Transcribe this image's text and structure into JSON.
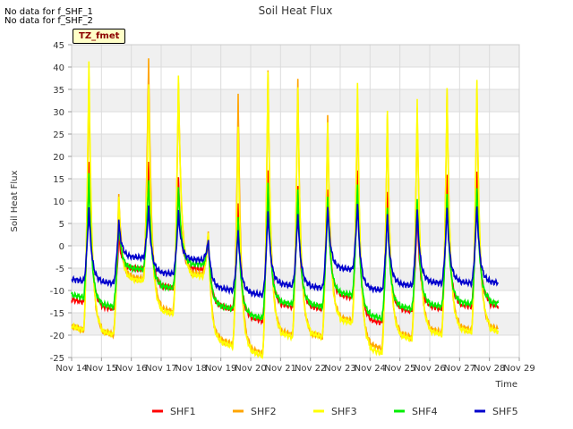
{
  "notes": [
    "No data for f_SHF_1",
    "No data for f_SHF_2"
  ],
  "tag_label": "TZ_fmet",
  "chart_data": {
    "type": "line",
    "title": "Soil Heat Flux",
    "xlabel": "Time",
    "ylabel": "Soil Heat Flux",
    "ylim": [
      -25,
      45
    ],
    "yticks": [
      -25,
      -20,
      -15,
      -10,
      -5,
      0,
      5,
      10,
      15,
      20,
      25,
      30,
      35,
      40,
      45
    ],
    "xlim": [
      14,
      29
    ],
    "xticks": [
      14,
      15,
      16,
      17,
      18,
      19,
      20,
      21,
      22,
      23,
      24,
      25,
      26,
      27,
      28,
      29
    ],
    "xtick_labels": [
      "Nov 14",
      "Nov 15",
      "Nov 16",
      "Nov 17",
      "Nov 18",
      "Nov 19",
      "Nov 20",
      "Nov 21",
      "Nov 22",
      "Nov 23",
      "Nov 24",
      "Nov 25",
      "Nov 26",
      "Nov 27",
      "Nov 28",
      "Nov 29"
    ],
    "grid": true,
    "legend_position": "bottom",
    "day_start": 14.0,
    "day_end": 28.3,
    "series": [
      {
        "name": "SHF1",
        "color": "#ff0000",
        "peaks": [
          19,
          2,
          18.5,
          15,
          1,
          9.5,
          17,
          13.5,
          12.5,
          16.5,
          11.5,
          8.5,
          15.5,
          16.5
        ],
        "troughs": [
          -12,
          -13.5,
          -5,
          -9,
          -5,
          -13.5,
          -16,
          -13,
          -13.5,
          -11,
          -16.5,
          -14,
          -13.5,
          -13,
          -12.5
        ]
      },
      {
        "name": "SHF2",
        "color": "#ffa500",
        "peaks": [
          38,
          12,
          42.5,
          37,
          3.5,
          34,
          39,
          37,
          29,
          33,
          29.5,
          31,
          35,
          35
        ],
        "troughs": [
          -18,
          -19,
          -7,
          -14,
          -6,
          -21,
          -23,
          -19,
          -19.5,
          -16,
          -22,
          -19.5,
          -18.5,
          -18,
          -18
        ]
      },
      {
        "name": "SHF3",
        "color": "#ffff00",
        "peaks": [
          41.5,
          11,
          36,
          38,
          3,
          27,
          39.5,
          36,
          28,
          36.5,
          30,
          32.5,
          35,
          37
        ],
        "troughs": [
          -18,
          -19,
          -7.5,
          -14.5,
          -6.5,
          -21.5,
          -23.5,
          -19.5,
          -19.5,
          -16.5,
          -23,
          -20,
          -19,
          -18.5,
          -18
        ]
      },
      {
        "name": "SHF4",
        "color": "#00ee00",
        "peaks": [
          16,
          5,
          15,
          13.5,
          1,
          6.5,
          14,
          12.5,
          11,
          14,
          9,
          11,
          12,
          13
        ],
        "troughs": [
          -11,
          -13,
          -5,
          -9,
          -4,
          -13.5,
          -15.5,
          -12.5,
          -13,
          -10.5,
          -15.5,
          -13.5,
          -13,
          -12.5,
          -12
        ]
      },
      {
        "name": "SHF5",
        "color": "#0000cc",
        "peaks": [
          8.5,
          5.5,
          8.5,
          7.5,
          1,
          3.5,
          8,
          7.5,
          9,
          9.5,
          7,
          8,
          8.5,
          9
        ],
        "troughs": [
          -7.5,
          -8,
          -2.5,
          -6,
          -3,
          -9.5,
          -10.5,
          -8.5,
          -9,
          -5,
          -9.5,
          -8.5,
          -8,
          -8,
          -8
        ]
      }
    ]
  }
}
